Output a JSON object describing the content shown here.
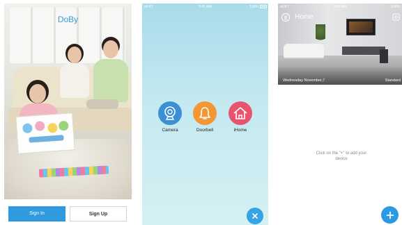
{
  "login": {
    "brand": "DoBy",
    "sign_in_label": "Sign In",
    "sign_up_label": "Sign Up"
  },
  "selector": {
    "status": {
      "carrier": "all KT",
      "time": "9:41 AM",
      "battery": "100%"
    },
    "apps": [
      {
        "label": "Camera",
        "icon": "camera-icon",
        "color": "#3b8fd4"
      },
      {
        "label": "Doorbell",
        "icon": "bell-icon",
        "color": "#f39634"
      },
      {
        "label": "iHome",
        "icon": "house-icon",
        "color": "#e8546e"
      }
    ],
    "close_icon": "close-icon"
  },
  "home": {
    "status": {
      "carrier": "all KT",
      "time": "9:41 AM",
      "battery": "100%"
    },
    "title": "Home",
    "date": "Wednesday November,7",
    "mode": "Standard",
    "empty_message": "Click on the \"+\" to add your device",
    "add_icon": "plus-icon",
    "accent": "#2b9ae4"
  }
}
